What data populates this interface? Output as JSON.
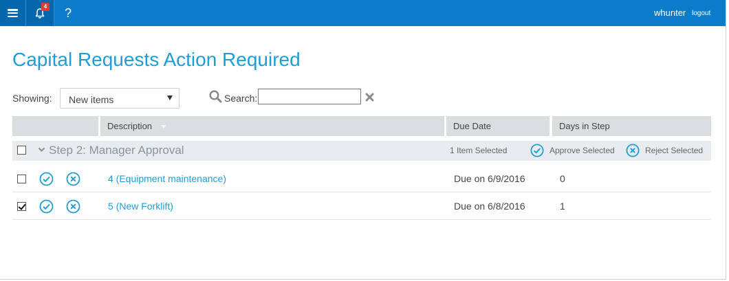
{
  "topbar": {
    "notifications_count": "4",
    "help_label": "?",
    "username": "whunter",
    "logout_label": "logout",
    "icons": {
      "menu": "menu-icon",
      "notifications": "bell-icon"
    },
    "colors": {
      "bar": "#0a7cc8",
      "active": "#0767ad",
      "badge": "#e53935"
    }
  },
  "page": {
    "title": "Capital Requests Action Required",
    "accent_color": "#1e9ed6"
  },
  "filter": {
    "showing_label": "Showing:",
    "selected_option": "New items",
    "search_label": "Search:",
    "search_value": ""
  },
  "table": {
    "columns": [
      "Description",
      "Due Date",
      "Days in Step"
    ],
    "sorted_column": "Description",
    "groups": [
      {
        "title": "Step 2: Manager Approval",
        "selected_count_text": "1 Item Selected",
        "approve_label": "Approve Selected",
        "reject_label": "Reject Selected",
        "rows": [
          {
            "description": "4 (Equipment maintenance)",
            "due": "Due on 6/9/2016",
            "days": "0",
            "checked": false
          },
          {
            "description": "5 (New Forklift)",
            "due": "Due on 6/8/2016",
            "days": "1",
            "checked": true
          }
        ]
      }
    ]
  }
}
